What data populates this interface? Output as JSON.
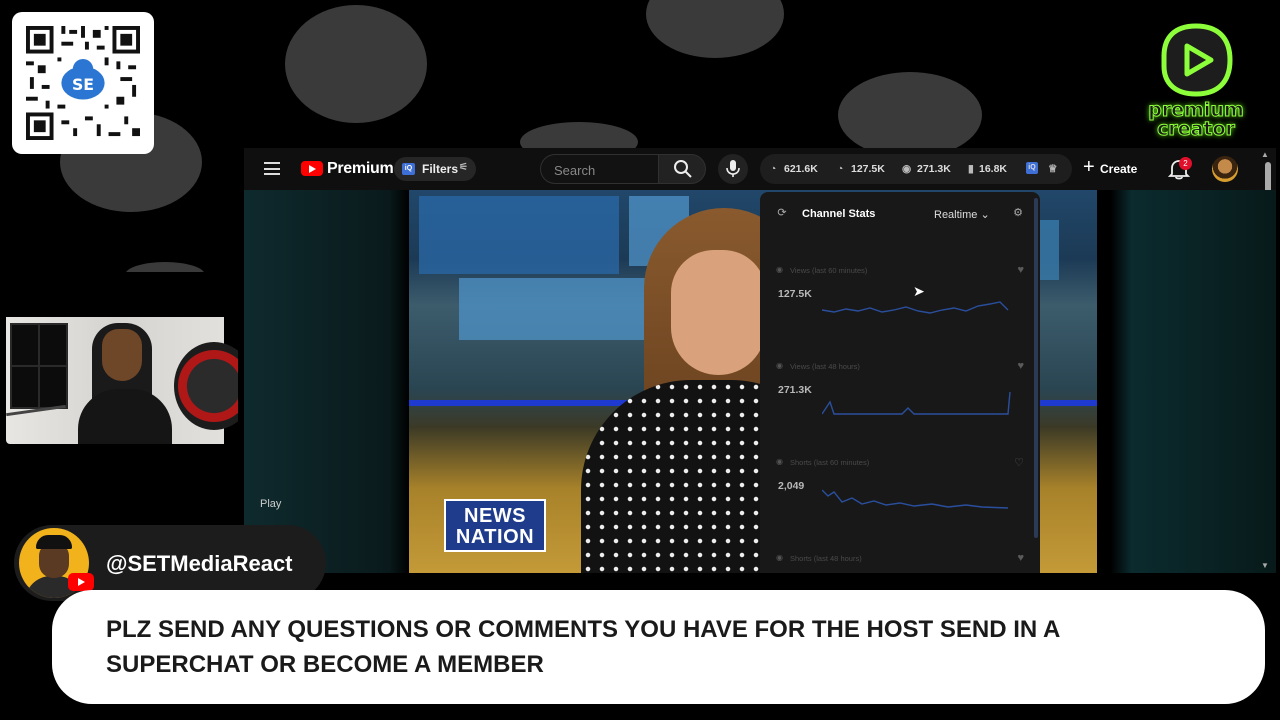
{
  "overlay": {
    "handle": "@SETMediaReact",
    "ticker_text": "PLZ SEND ANY QUESTIONS OR COMMENTS YOU HAVE FOR THE HOST SEND IN A SUPERCHAT OR BECOME A MEMBER",
    "badge_line1": "premium",
    "badge_line2": "creator",
    "badge_color": "#8dff3a"
  },
  "youtube": {
    "logo_label": "Premium",
    "filters_label": "Filters",
    "search_placeholder": "Search",
    "stats": [
      {
        "icon": "trend-icon",
        "value": "621.6K"
      },
      {
        "icon": "users-icon",
        "value": "127.5K"
      },
      {
        "icon": "eye-icon",
        "value": "271.3K"
      },
      {
        "icon": "shorts-icon",
        "value": "16.8K"
      }
    ],
    "create_label": "Create",
    "notification_count": "2",
    "accent": "#ff0000"
  },
  "player": {
    "play_label": "Play",
    "news_logo_line1": "NEWS",
    "news_logo_line2": "NATION"
  },
  "channel_stats": {
    "title": "Channel Stats",
    "mode": "Realtime",
    "cards": [
      {
        "label": "Views (last 60 minutes)",
        "value": "127.5K"
      },
      {
        "label": "Views (last 48 hours)",
        "value": "271.3K"
      },
      {
        "label": "Shorts (last 60 minutes)",
        "value": "2,049"
      },
      {
        "label": "Shorts (last 48 hours)",
        "value": ""
      }
    ]
  }
}
